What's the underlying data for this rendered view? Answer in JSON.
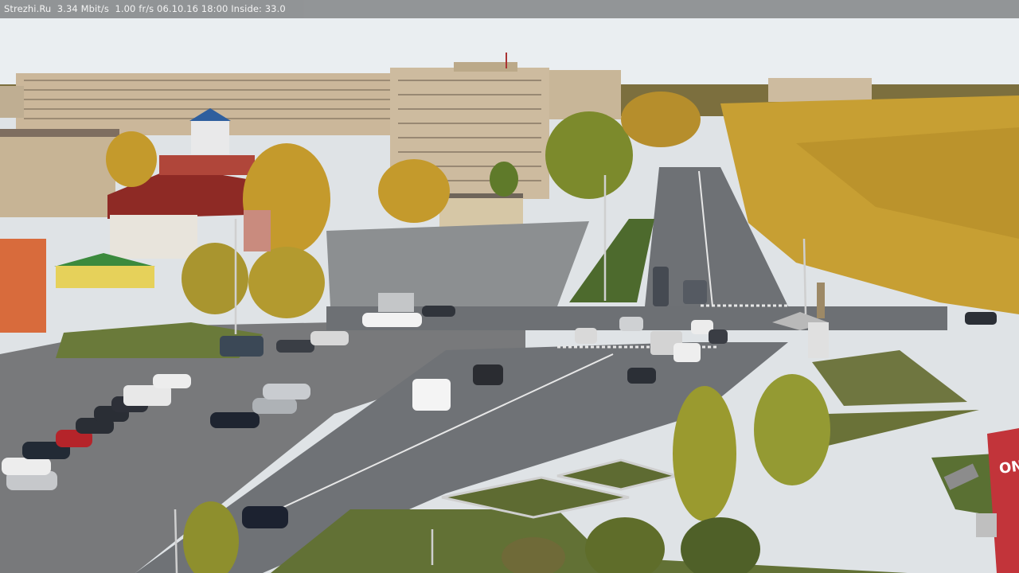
{
  "overlay": {
    "text": "Strezhi.Ru  3.34 Mbit/s  1.00 fr/s 06.10.16 18:00 Inside: 33.0"
  },
  "scene": {
    "sign_text": "ONS",
    "colors": {
      "sky": "#e9eef1",
      "road": "#6f7478",
      "lot": "#7a7d80",
      "grass": "#6b7a3a",
      "autumn_tree": "#c7a132",
      "building_beige": "#c9b99d",
      "building_red": "#8e2a25"
    }
  }
}
